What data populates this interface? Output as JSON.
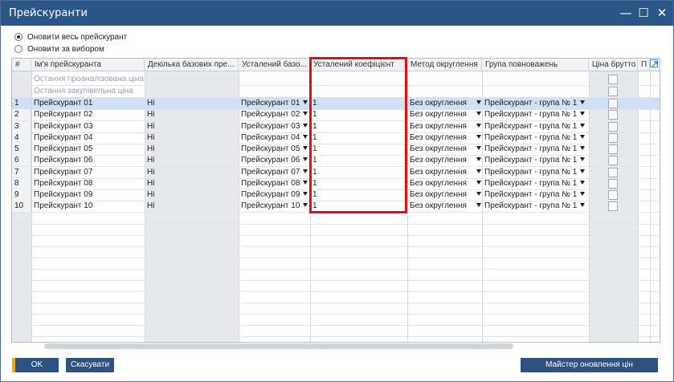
{
  "window": {
    "title": "Прейскуранти",
    "min_icon": "minimize-icon",
    "max_icon": "maximize-icon",
    "close_icon": "close-icon"
  },
  "options": [
    {
      "label": "Оновити весь прейскурант",
      "checked": true
    },
    {
      "label": "Оновити за вибором",
      "checked": false
    }
  ],
  "table": {
    "columns": [
      "#",
      "Ім'я прейскуранта",
      "Декілька базових пре...",
      "Усталений базо...",
      "Усталений коефіцієнт",
      "Метод округлення",
      "Група повноважень",
      "Ціна брутто",
      "П"
    ],
    "special_rows": [
      {
        "name": "Остання проаналізована ціна"
      },
      {
        "name": "Остання закупівельна ціна"
      }
    ],
    "rows": [
      {
        "num": "1",
        "name": "Прейскурант 01",
        "multi": "Ні",
        "base": "Прейскурант 01",
        "factor": "1",
        "rounding": "Без округлення",
        "group": "Прейскурант - група № 1"
      },
      {
        "num": "2",
        "name": "Прейскурант 02",
        "multi": "Ні",
        "base": "Прейскурант 02",
        "factor": "1",
        "rounding": "Без округлення",
        "group": "Прейскурант - група № 1"
      },
      {
        "num": "3",
        "name": "Прейскурант 03",
        "multi": "Ні",
        "base": "Прейскурант 03",
        "factor": "1",
        "rounding": "Без округлення",
        "group": "Прейскурант - група № 1"
      },
      {
        "num": "4",
        "name": "Прейскурант 04",
        "multi": "Ні",
        "base": "Прейскурант 04",
        "factor": "1",
        "rounding": "Без округлення",
        "group": "Прейскурант - група № 1"
      },
      {
        "num": "5",
        "name": "Прейскурант 05",
        "multi": "Ні",
        "base": "Прейскурант 05",
        "factor": "1",
        "rounding": "Без округлення",
        "group": "Прейскурант - група № 1"
      },
      {
        "num": "6",
        "name": "Прейскурант 06",
        "multi": "Ні",
        "base": "Прейскурант 06",
        "factor": "1",
        "rounding": "Без округлення",
        "group": "Прейскурант - група № 1"
      },
      {
        "num": "7",
        "name": "Прейскурант 07",
        "multi": "Ні",
        "base": "Прейскурант 07",
        "factor": "1",
        "rounding": "Без округлення",
        "group": "Прейскурант - група № 1"
      },
      {
        "num": "8",
        "name": "Прейскурант 08",
        "multi": "Ні",
        "base": "Прейскурант 08",
        "factor": "1",
        "rounding": "Без округлення",
        "group": "Прейскурант - група № 1"
      },
      {
        "num": "9",
        "name": "Прейскурант 09",
        "multi": "Ні",
        "base": "Прейскурант 09",
        "factor": "1",
        "rounding": "Без округлення",
        "group": "Прейскурант - група № 1"
      },
      {
        "num": "10",
        "name": "Прейскурант 10",
        "multi": "Ні",
        "base": "Прейскурант 10",
        "factor": "1",
        "rounding": "Без округлення",
        "group": "Прейскурант - група № 1"
      }
    ],
    "selected_row": "1"
  },
  "buttons": {
    "ok": "OK",
    "cancel": "Скасувати",
    "wizard": "Майстер оновлення цін"
  },
  "colors": {
    "titlebar": "#2b5788",
    "button": "#2d5181",
    "ok_accent": "#f0ab00",
    "highlight_box": "#e10f12",
    "selected_row": "#cfe1f7"
  }
}
